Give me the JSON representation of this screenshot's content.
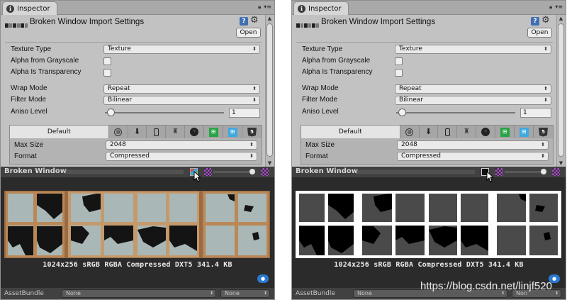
{
  "panels": [
    {
      "id": "left",
      "tab": {
        "label": "Inspector"
      },
      "header": {
        "title": "Broken Window Import Settings",
        "open_label": "Open"
      },
      "properties": {
        "texture_type": {
          "label": "Texture Type",
          "value": "Texture"
        },
        "alpha_from_grayscale": {
          "label": "Alpha from Grayscale",
          "checked": false
        },
        "alpha_is_transparency": {
          "label": "Alpha Is Transparency",
          "checked": false
        },
        "wrap_mode": {
          "label": "Wrap Mode",
          "value": "Repeat"
        },
        "filter_mode": {
          "label": "Filter Mode",
          "value": "Bilinear"
        },
        "aniso_level": {
          "label": "Aniso Level",
          "value": "1"
        }
      },
      "platform": {
        "default_tab": "Default",
        "icons": [
          "globe-icon",
          "download-icon",
          "phone-icon",
          "android-icon",
          "blackberry-icon",
          "windows-store-icon",
          "windows-phone-icon",
          "html5-icon"
        ],
        "max_size": {
          "label": "Max Size",
          "value": "2048"
        },
        "format": {
          "label": "Format",
          "value": "Compressed"
        }
      },
      "preview": {
        "title": "Broken Window",
        "channel_mode": "rgb",
        "info": "1024x256 sRGB  RGBA Compressed DXT5   341.4 KB"
      },
      "asset_bundle": {
        "label": "AssetBundle",
        "name": "None",
        "variant": "None"
      }
    },
    {
      "id": "right",
      "tab": {
        "label": "Inspector"
      },
      "header": {
        "title": "Broken Window Import Settings",
        "open_label": "Open"
      },
      "properties": {
        "texture_type": {
          "label": "Texture Type",
          "value": "Texture"
        },
        "alpha_from_grayscale": {
          "label": "Alpha from Grayscale",
          "checked": false
        },
        "alpha_is_transparency": {
          "label": "Alpha Is Transparency",
          "checked": false
        },
        "wrap_mode": {
          "label": "Wrap Mode",
          "value": "Repeat"
        },
        "filter_mode": {
          "label": "Filter Mode",
          "value": "Bilinear"
        },
        "aniso_level": {
          "label": "Aniso Level",
          "value": "1"
        }
      },
      "platform": {
        "default_tab": "Default",
        "icons": [
          "globe-icon",
          "download-icon",
          "phone-icon",
          "android-icon",
          "blackberry-icon",
          "windows-store-icon",
          "windows-phone-icon",
          "html5-icon"
        ],
        "max_size": {
          "label": "Max Size",
          "value": "2048"
        },
        "format": {
          "label": "Format",
          "value": "Compressed"
        }
      },
      "preview": {
        "title": "Broken Window",
        "channel_mode": "alpha",
        "info": "1024x256 sRGB  RGBA Compressed DXT5   341.4 KB"
      },
      "asset_bundle": {
        "label": "AssetBundle",
        "name": "None",
        "variant": "Non"
      }
    }
  ],
  "watermark": "https://blog.csdn.net/linjf520",
  "colors": {
    "panel_bg": "#c2c2c2",
    "preview_bg": "#2b2b2b",
    "frame_wood": "#a06a3a",
    "glass": "#aebdbd",
    "alpha_white": "#ffffff",
    "alpha_gray": "#4a4a4a"
  }
}
